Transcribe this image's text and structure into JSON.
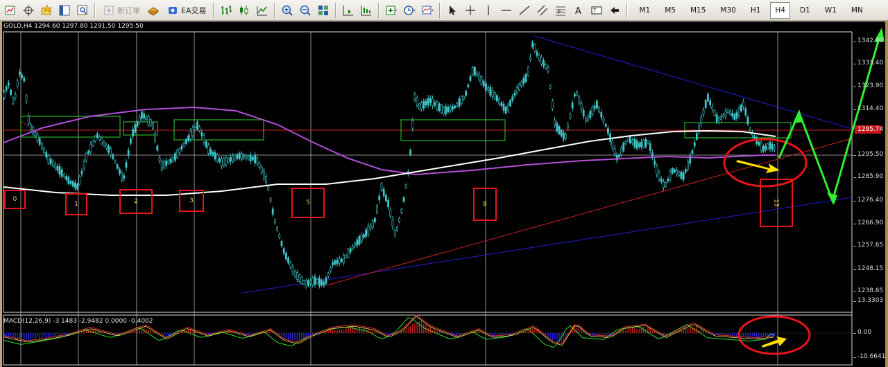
{
  "toolbar": {
    "new_order_label": "新订单",
    "ea_label": "EA交易",
    "timeframes": [
      "M1",
      "M5",
      "M15",
      "M30",
      "H1",
      "H4",
      "D1",
      "W1",
      "MN"
    ],
    "active_timeframe": "H4",
    "icons": [
      "new-chart-icon",
      "crosshair-icon",
      "favorites-icon",
      "navigator-icon",
      "zoom-window-icon",
      "new-order-icon",
      "ea-toggle-icon",
      "bar-chart-icon",
      "candlestick-icon",
      "line-chart-icon",
      "zoom-in-icon",
      "zoom-out-icon",
      "tile-windows-icon",
      "scroll-chart-icon",
      "chart-shift-icon",
      "indicators-icon",
      "periods-icon",
      "templates-icon",
      "cursor-icon",
      "cross-icon",
      "trendline-icon",
      "fibo-icon",
      "text-icon",
      "label-icon",
      "arrows-icon"
    ]
  },
  "chart": {
    "header": "GOLD,H4  1294.60 1297.80 1291.50 1295.50",
    "current_price_label": "1295.74",
    "price_labels": [
      "1342.90",
      "1333.40",
      "1323.90",
      "1314.40",
      "1295.50",
      "1285.90",
      "1276.40",
      "1266.90",
      "1257.65",
      "1248.15",
      "1238.65"
    ],
    "wave_labels": [
      "0",
      "1",
      "2",
      "3",
      "5",
      "8",
      "13"
    ],
    "colors": {
      "background": "#000000",
      "candles": "#3ec6c8",
      "purple_ma": "#b34fd9",
      "white_ma": "#ffffff",
      "red_line": "#d11f23",
      "blue_line": "#1f1fd6",
      "green_forecast": "#2ef02e",
      "yellow_arrow": "#ffe000",
      "annotation_red": "#e8141c"
    }
  },
  "macd": {
    "header": "MACD(12,26,9) -3.1483 -2.9482 0.0000 -0.4002",
    "scale_labels": [
      "13.3303",
      "0.00",
      "-10.6641"
    ]
  },
  "chart_data": {
    "type": "candlestick",
    "title": "GOLD,H4",
    "y_range": [
      1238.65,
      1342.9
    ],
    "open": 1294.6,
    "high": 1297.8,
    "low": 1291.5,
    "close": 1295.5,
    "current_price": 1295.74,
    "indicator": "MACD(12,26,9)",
    "macd_values": [
      -3.1483,
      -2.9482,
      0.0,
      -0.4002
    ],
    "macd_range": [
      -10.6641,
      13.3303
    ]
  }
}
